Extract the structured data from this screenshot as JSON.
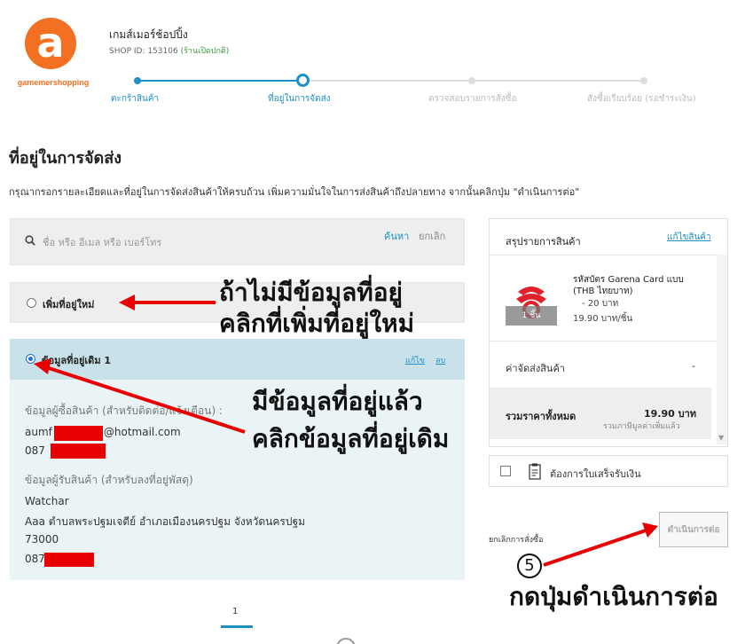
{
  "shop": {
    "logo_text": "gamemershopping",
    "name": "เกมส์เมอร์ช้อปปิ้ง",
    "id_label": "SHOP ID: 153106",
    "status": "(ร้านเปิดปกติ)"
  },
  "steps": [
    {
      "label": "ตะกร้าสินค้า"
    },
    {
      "label": "ที่อยู่ในการจัดส่ง"
    },
    {
      "label": "ตรวจสอบรายการสั่งซื้อ"
    },
    {
      "label": "สั่งซื้อเรียบร้อย (รอชำระเงิน)"
    }
  ],
  "page": {
    "title": "ที่อยู่ในการจัดส่ง",
    "description": "กรุณากรอกรายละเอียดและที่อยู่ในการจัดส่งสินค้าให้ครบถ้วน เพิ่มความมั่นใจในการส่งสินค้าถึงปลายทาง จากนั้นคลิกปุ่ม \"ดำเนินการต่อ\""
  },
  "search": {
    "placeholder": "ชื่อ หรือ อีเมล หรือ เบอร์โทร",
    "search_label": "ค้นหา",
    "cancel_label": "ยกเลิก"
  },
  "address_options": {
    "new_label": "เพิ่มที่อยู่ใหม่",
    "existing_label": "ข้อมูลที่อยู่เดิม 1",
    "edit_label": "แก้ไข",
    "delete_label": "ลบ"
  },
  "existing_address": {
    "buyer_heading": "ข้อมูลผู้ซื้อสินค้า (สำหรับติดต่อ/แจ้งเตือน) :",
    "buyer_email_prefix": "aumf",
    "buyer_email_suffix": "@hotmail.com",
    "buyer_phone_prefix": "087",
    "recipient_heading": "ข้อมูลผู้รับสินค้า (สำหรับลงที่อยู่พัสดุ)",
    "recipient_name": "Watchar",
    "recipient_address": "Aaa ตำบลพระปฐมเจดีย์ อำเภอเมืองนครปฐม จังหวัดนครปฐม",
    "recipient_postcode": "73000",
    "recipient_phone_prefix": "087"
  },
  "pagination": {
    "current": "1"
  },
  "summary": {
    "title": "สรุปรายการสินค้า",
    "edit_label": "แก้ไขสินค้า",
    "product_name": "รหัสบัตร Garena Card แบบ (THB ไทยบาท)",
    "product_variant": "- 20 บาท",
    "product_price": "19.90 บาท/ชิ้น",
    "product_qty": "1 ชิ้น",
    "shipping_label": "ค่าจัดส่งสินค้า",
    "shipping_value": "-",
    "total_label": "รวมราคาทั้งหมด",
    "total_value": "19.90 บาท",
    "vat_note": "รวมภาษีมูลค่าเพิ่มแล้ว"
  },
  "invoice": {
    "label": "ต้องการใบเสร็จรับเงิน"
  },
  "actions": {
    "cancel_order": "ยกเลิกการสั่งซื้อ",
    "continue": "ดำเนินการต่อ"
  },
  "annotations": {
    "no_address_line1": "ถ้าไม่มีข้อมูลที่อยู่",
    "no_address_line2": "คลิกที่เพิ่มที่อยู่ใหม่",
    "has_address_line1": "มีข้อมูลที่อยู่แล้ว",
    "has_address_line2": "คลิกข้อมูลที่อยู่เดิม",
    "step_number": "5",
    "press_continue": "กดปุ่มดำเนินการต่อ"
  },
  "colors": {
    "accent": "#1e90c8",
    "brand_orange": "#f36f21",
    "annotation_red": "#e80000"
  }
}
